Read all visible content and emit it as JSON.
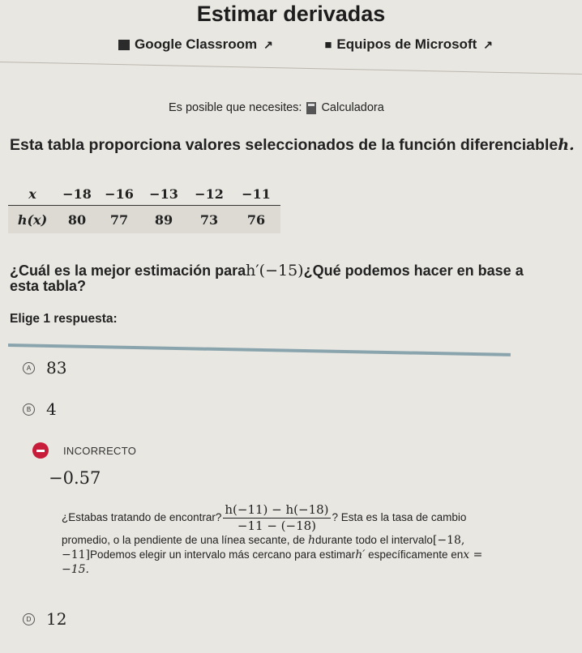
{
  "header": {
    "title": "Estimar derivadas",
    "google_classroom": "Google Classroom",
    "microsoft_teams": "Equipos de Microsoft"
  },
  "tools": {
    "prefix": "Es posible que necesites:",
    "calculator": "Calculadora"
  },
  "question": {
    "intro": "Esta tabla proporciona valores seleccionados de la función diferenciable",
    "function_name": "h.",
    "table": {
      "row_x": [
        "x",
        "−18",
        "−16",
        "−13",
        "−12",
        "−11"
      ],
      "row_h": [
        "h(x)",
        "80",
        "77",
        "89",
        "73",
        "76"
      ]
    },
    "text_part1": "¿Cuál es la mejor estimación para",
    "math_expr": "h′(−15)",
    "text_part2": "¿Qué podemos hacer en base a esta tabla?"
  },
  "answer": {
    "prompt": "Elige 1 respuesta:",
    "options": [
      {
        "letter": "A",
        "value": "83"
      },
      {
        "letter": "B",
        "value": "4"
      },
      {
        "letter": "D",
        "value": "12"
      }
    ],
    "selected": {
      "status": "INCORRECTO",
      "value": "−0.57"
    },
    "feedback": {
      "p1": "¿Estabas tratando de encontrar?",
      "frac_num": "h(−11) − h(−18)",
      "frac_den": "−11 − (−18)",
      "p2": "? Esta es la tasa de cambio promedio, o la pendiente de una línea secante, de",
      "h1": "h",
      "p3": "durante todo el intervalo",
      "interval": "[−18, −11]",
      "p4": "Podemos elegir un intervalo más cercano para estimar",
      "hprime": "h′",
      "p5": "específicamente en",
      "xeq": "x = −15."
    }
  },
  "colors": {
    "background": "#e9e7e1",
    "incorrect_red": "#c81d3a",
    "rule_blue": "#8aa4ad"
  }
}
